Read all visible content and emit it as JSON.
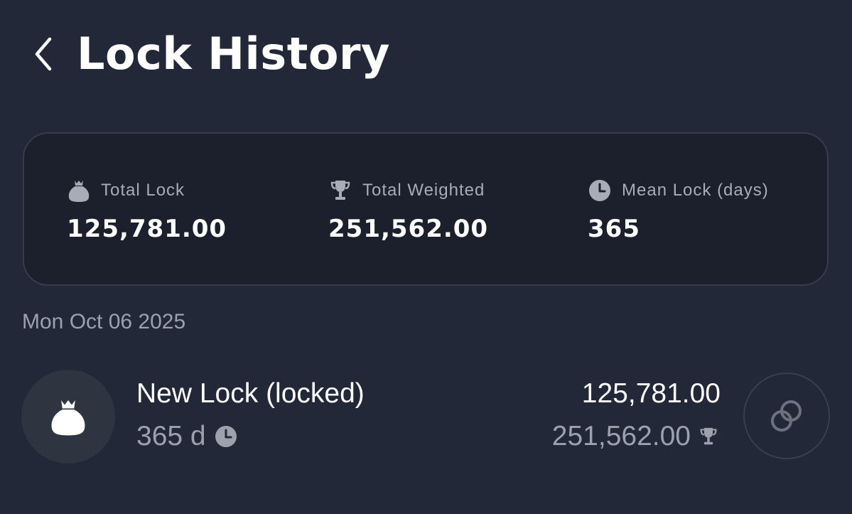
{
  "header": {
    "title": "Lock History",
    "back_icon": "chevron-left-icon"
  },
  "summary": {
    "total_lock": {
      "label": "Total Lock",
      "value": "125,781.00",
      "icon": "money-bag-icon"
    },
    "total_weighted": {
      "label": "Total Weighted",
      "value": "251,562.00",
      "icon": "trophy-icon"
    },
    "mean_lock": {
      "label": "Mean Lock (days)",
      "value": "365",
      "icon": "clock-icon"
    }
  },
  "history": {
    "date": "Mon Oct 06 2025",
    "items": [
      {
        "title": "New Lock (locked)",
        "duration": "365 d",
        "amount": "125,781.00",
        "weighted": "251,562.00",
        "icon": "money-bag-icon",
        "action_icon": "link-icon"
      }
    ]
  },
  "colors": {
    "background": "#232838",
    "card": "#1b202c",
    "muted_text": "#9da1ab"
  }
}
